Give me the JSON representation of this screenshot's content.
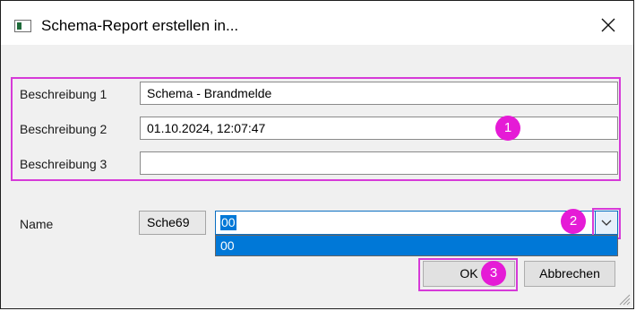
{
  "window": {
    "title": "Schema-Report erstellen in..."
  },
  "form": {
    "rows": [
      {
        "label": "Beschreibung 1",
        "value": "Schema - Brandmelde"
      },
      {
        "label": "Beschreibung 2",
        "value": "01.10.2024, 12:07:47"
      },
      {
        "label": "Beschreibung 3",
        "value": ""
      }
    ],
    "name": {
      "label": "Name",
      "prefix": "Sche69",
      "value": "00",
      "dropdown_options": [
        "00"
      ]
    }
  },
  "markers": [
    "1",
    "2",
    "3"
  ],
  "buttons": {
    "ok": "OK",
    "cancel": "Abbrechen"
  },
  "colors": {
    "highlight": "#d63ad8",
    "marker": "#e51bd6",
    "selection": "#0078d7"
  }
}
